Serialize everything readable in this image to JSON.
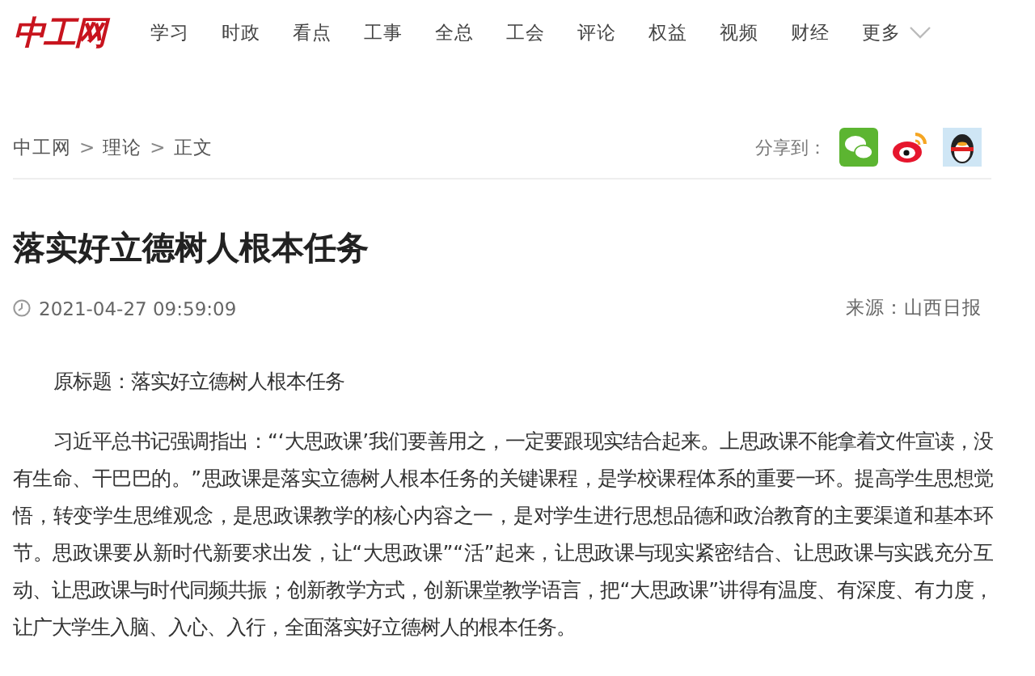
{
  "logo": "中工网",
  "nav": [
    {
      "label": "学习"
    },
    {
      "label": "时政"
    },
    {
      "label": "看点"
    },
    {
      "label": "工事"
    },
    {
      "label": "全总"
    },
    {
      "label": "工会"
    },
    {
      "label": "评论"
    },
    {
      "label": "权益"
    },
    {
      "label": "视频"
    },
    {
      "label": "财经"
    },
    {
      "label": "更多"
    }
  ],
  "breadcrumb": {
    "separator": ">",
    "items": [
      "中工网",
      "理论",
      "正文"
    ]
  },
  "share": {
    "label": "分享到："
  },
  "article": {
    "title": "落实好立德树人根本任务",
    "date": "2021-04-27 09:59:09",
    "source": "来源：山西日报",
    "paragraphs": [
      "原标题：落实好立德树人根本任务",
      "习近平总书记强调指出：“‘大思政课’我们要善用之，一定要跟现实结合起来。上思政课不能拿着文件宣读，没有生命、干巴巴的。”思政课是落实立德树人根本任务的关键课程，是学校课程体系的重要一环。提高学生思想觉悟，转变学生思维观念，是思政课教学的核心内容之一，是对学生进行思想品德和政治教育的主要渠道和基本环节。思政课要从新时代新要求出发，让“大思政课”“活”起来，让思政课与现实紧密结合、让思政课与实践充分互动、让思政课与时代同频共振；创新教学方式，创新课堂教学语言，把“大思政课”讲得有温度、有深度、有力度，让广大学生入脑、入心、入行，全面落实好立德树人的根本任务。"
    ]
  }
}
